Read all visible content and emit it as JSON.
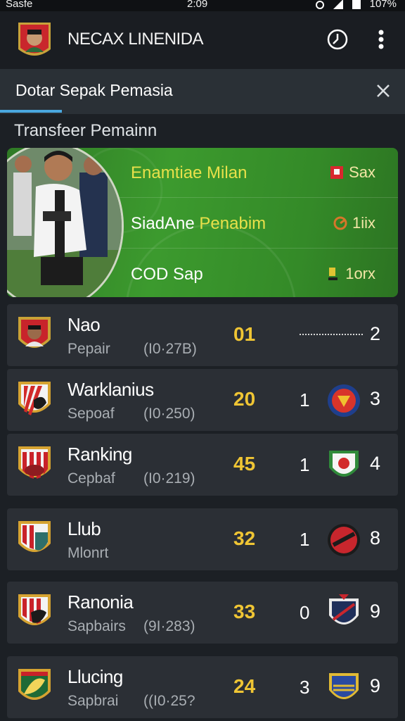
{
  "status_bar": {
    "left": "Sasfe",
    "time": "2:09",
    "battery": "107%"
  },
  "app": {
    "title": "NECAX LINENIDA"
  },
  "banner": {
    "title": "Dotar Sepak Pemasia"
  },
  "section": {
    "title": "Transfeer Pemainn"
  },
  "featured": {
    "rows": [
      {
        "label": "Enamtiae Milan",
        "stat": "Sax"
      },
      {
        "label_part1": "SiadAne",
        "label_part2": "Penabim",
        "stat": "1iix"
      },
      {
        "label": "COD Sap",
        "stat": "1orx"
      }
    ]
  },
  "teams": [
    {
      "name": "Nao",
      "sub": "Pepair",
      "extra": "(I0·27B)",
      "score": "01",
      "mid": "",
      "rank": "2"
    },
    {
      "name": "Warklanius",
      "sub": "Sepoaf",
      "extra": "(I0·250)",
      "score": "20",
      "mid": "1",
      "rank": "3"
    },
    {
      "name": "Ranking",
      "sub": "Cepbaf",
      "extra": "(I0·219)",
      "score": "45",
      "mid": "1",
      "rank": "4"
    },
    {
      "name": "Llub",
      "sub": "Mlonrt",
      "extra": "",
      "score": "32",
      "mid": "1",
      "rank": "8"
    },
    {
      "name": "Ranonia",
      "sub": "Sapbairs",
      "extra": "(9I·283)",
      "score": "33",
      "mid": "0",
      "rank": "9"
    },
    {
      "name": "Llucing",
      "sub": "Sapbrai",
      "extra": "((I0·25?",
      "score": "24",
      "mid": "3",
      "rank": "9"
    }
  ],
  "colors": {
    "background": "#1c2025",
    "card": "#2b2f35",
    "accent_blue": "#4aa8e0",
    "score_yellow": "#efc534",
    "feature_green": "#3c9a2e",
    "feature_text_yellow": "#e8e04a"
  },
  "icons": {
    "app_logo": "player-portrait-crest-icon",
    "clock": "clock-icon",
    "more": "more-vertical-icon",
    "close": "close-icon"
  }
}
